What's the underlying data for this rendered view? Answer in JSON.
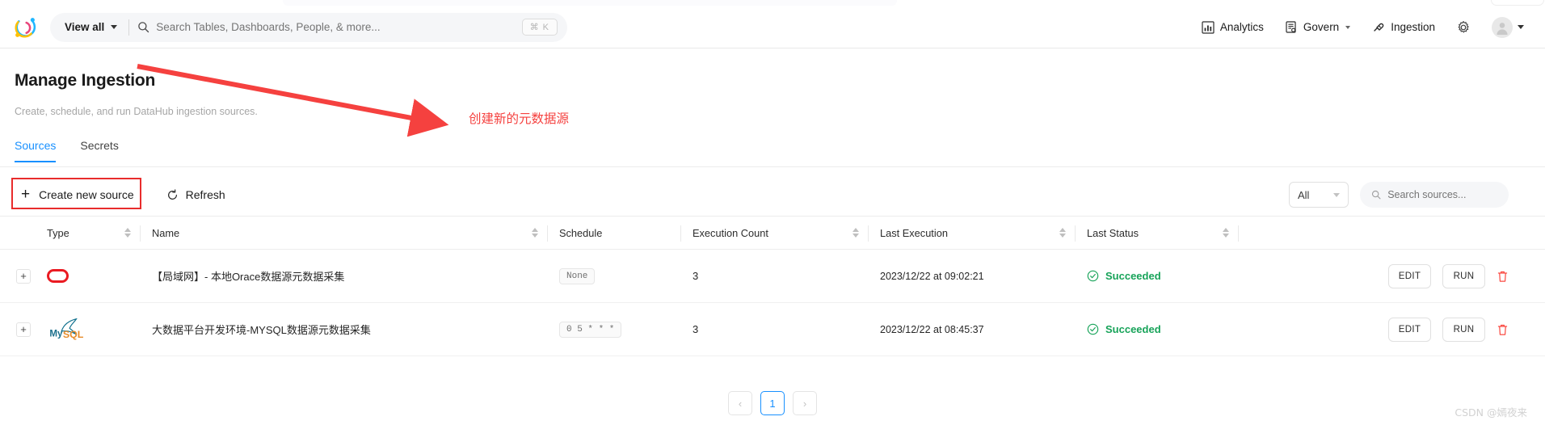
{
  "topbar": {
    "logo_name": "datahub-logo",
    "view_all_label": "View all",
    "search_placeholder": "Search Tables, Dashboards, People, & more...",
    "search_value": "",
    "kbd_shortcut": "⌘ K",
    "nav": [
      {
        "label": "Analytics",
        "icon": "bar-chart-icon",
        "has_caret": false
      },
      {
        "label": "Govern",
        "icon": "governance-icon",
        "has_caret": true
      },
      {
        "label": "Ingestion",
        "icon": "plug-icon",
        "has_caret": false
      }
    ],
    "settings_icon": "gear-icon",
    "avatar_icon": "user-avatar-icon"
  },
  "header": {
    "title": "Manage Ingestion",
    "subtitle": "Create, schedule, and run DataHub ingestion sources."
  },
  "tabs": [
    {
      "label": "Sources",
      "active": true
    },
    {
      "label": "Secrets",
      "active": false
    }
  ],
  "annotation": {
    "text": "创建新的元数据源",
    "color": "#f5413f"
  },
  "toolbar": {
    "create_label": "Create new source",
    "refresh_label": "Refresh",
    "filter_value": "All",
    "search_placeholder": "Search sources...",
    "search_value": ""
  },
  "table": {
    "columns": [
      {
        "key": "expand",
        "label": "",
        "sortable": false
      },
      {
        "key": "type",
        "label": "Type",
        "sortable": true
      },
      {
        "key": "name",
        "label": "Name",
        "sortable": true
      },
      {
        "key": "schedule",
        "label": "Schedule",
        "sortable": false
      },
      {
        "key": "execution_count",
        "label": "Execution Count",
        "sortable": true
      },
      {
        "key": "last_execution",
        "label": "Last Execution",
        "sortable": true
      },
      {
        "key": "last_status",
        "label": "Last Status",
        "sortable": true
      },
      {
        "key": "actions",
        "label": "",
        "sortable": false
      }
    ],
    "rows": [
      {
        "expand": "+",
        "type_icon": "oracle-icon",
        "name": "【局域网】- 本地Orace数据源元数据采集",
        "schedule": "None",
        "execution_count": "3",
        "last_execution": "2023/12/22 at 09:02:21",
        "last_status": "Succeeded",
        "edit_label": "EDIT",
        "run_label": "RUN",
        "delete_icon": "trash-icon"
      },
      {
        "expand": "+",
        "type_icon": "mysql-icon",
        "name": "大数据平台开发环境-MYSQL数据源元数据采集",
        "schedule": "0 5 * * *",
        "execution_count": "3",
        "last_execution": "2023/12/22 at 08:45:37",
        "last_status": "Succeeded",
        "edit_label": "EDIT",
        "run_label": "RUN",
        "delete_icon": "trash-icon"
      }
    ]
  },
  "pagination": {
    "prev_label": "‹",
    "current_page": "1",
    "next_label": "›"
  },
  "watermark": "CSDN @嫣夜来",
  "colors": {
    "accent": "#1890ff",
    "success": "#17a359",
    "danger": "#e82c2c",
    "annotation": "#f5413f"
  }
}
